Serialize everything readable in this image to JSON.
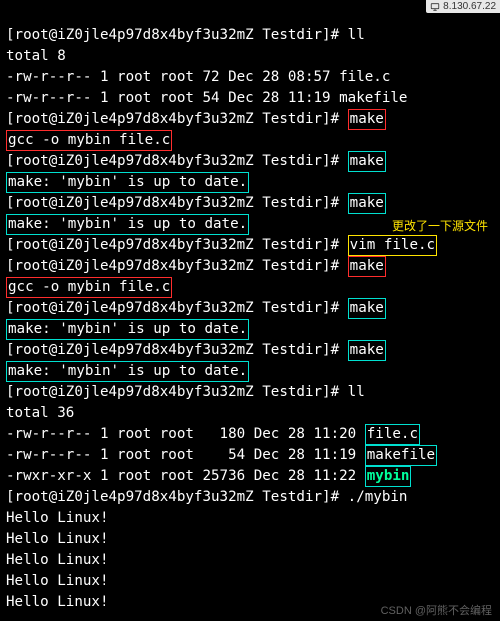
{
  "ip_badge": "8.130.67.22",
  "prompt": "[root@iZ0jle4p97d8x4byf3u32mZ Testdir]#",
  "cmd_ll": "ll",
  "total8": "total 8",
  "ls1_line1": "-rw-r--r-- 1 root root 72 Dec 28 08:57 file.c",
  "ls1_line2": "-rw-r--r-- 1 root root 54 Dec 28 11:19 makefile",
  "cmd_make": "make",
  "gcc_line": "gcc -o mybin file.c",
  "uptodate": "make: 'mybin' is up to date.",
  "cmd_vim": "vim file.c",
  "zh_note": "更改了一下源文件",
  "total36": "total 36",
  "ls2_line1_pre": "-rw-r--r-- 1 root root   180 Dec 28 11:20 ",
  "ls2_line1_file": "file.c",
  "ls2_line2_pre": "-rw-r--r-- 1 root root    54 Dec 28 11:19 ",
  "ls2_line2_file": "makefile",
  "ls2_line3_pre": "-rwxr-xr-x 1 root root 25736 Dec 28 11:22 ",
  "ls2_line3_file": "mybin",
  "cmd_run": "./mybin",
  "hello": "Hello Linux!",
  "watermark": "CSDN @阿熊不会编程"
}
